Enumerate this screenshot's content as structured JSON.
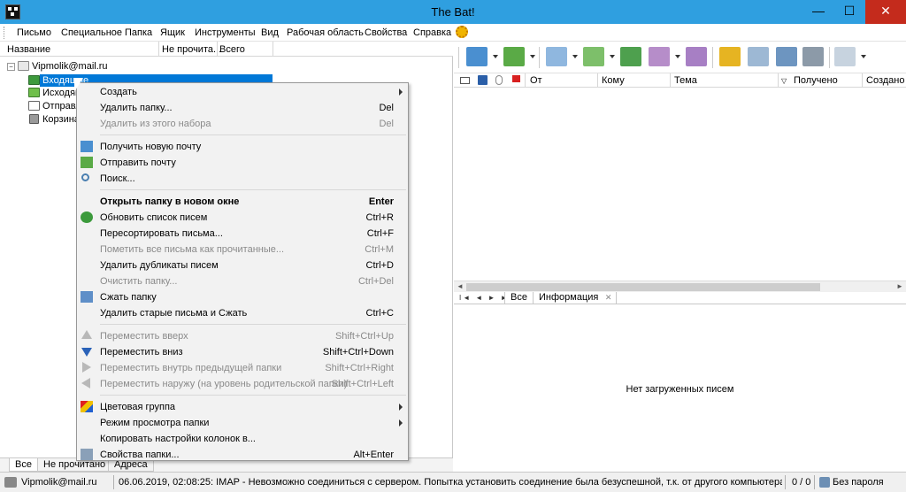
{
  "window": {
    "title": "The Bat!",
    "minimize": "—",
    "maximize": "☐",
    "close": "✕"
  },
  "menubar": [
    "Письмо",
    "Специальное",
    "Папка",
    "Ящик",
    "Инструменты",
    "Вид",
    "Рабочая область",
    "Свойства",
    "Справка"
  ],
  "folder_pane": {
    "columns": [
      "Название",
      "Не прочита...",
      "Всего"
    ],
    "account": "Vipmolik@mail.ru",
    "folders": [
      {
        "label": "Входящие",
        "icon": "inbox-icon",
        "selected": true
      },
      {
        "label": "Исходящие",
        "icon": "outbox-icon"
      },
      {
        "label": "Отправленные",
        "icon": "sent-icon"
      },
      {
        "label": "Корзина",
        "icon": "trash-icon"
      }
    ],
    "tabs": [
      "Все",
      "Не прочитано",
      "Адреса"
    ]
  },
  "context_menu": {
    "items": [
      {
        "label": "Создать",
        "shortcut": "",
        "submenu": true,
        "disabled": false
      },
      {
        "label": "Удалить папку...",
        "shortcut": "Del",
        "disabled": false
      },
      {
        "label": "Удалить из этого набора",
        "shortcut": "Del",
        "disabled": true
      },
      {
        "label": "Получить новую почту",
        "shortcut": "",
        "icon": "get-mail-icon"
      },
      {
        "label": "Отправить почту",
        "shortcut": "",
        "icon": "send-mail-icon"
      },
      {
        "label": "Поиск...",
        "shortcut": "",
        "icon": "search-icon"
      },
      {
        "label": "Открыть папку в новом окне",
        "shortcut": "Enter",
        "bold": true
      },
      {
        "label": "Обновить список писем",
        "shortcut": "Ctrl+R",
        "icon": "refresh-icon"
      },
      {
        "label": "Пересортировать письма...",
        "shortcut": "Ctrl+F"
      },
      {
        "label": "Пометить все письма как прочитанные...",
        "shortcut": "Ctrl+M",
        "disabled": true
      },
      {
        "label": "Удалить дубликаты писем",
        "shortcut": "Ctrl+D"
      },
      {
        "label": "Очистить папку...",
        "shortcut": "Ctrl+Del",
        "disabled": true
      },
      {
        "label": "Сжать папку",
        "shortcut": "",
        "icon": "compress-icon"
      },
      {
        "label": "Удалить старые письма и Сжать",
        "shortcut": "Ctrl+C"
      },
      {
        "label": "Переместить вверх",
        "shortcut": "Shift+Ctrl+Up",
        "disabled": true,
        "icon": "arrow-up-icon"
      },
      {
        "label": "Переместить вниз",
        "shortcut": "Shift+Ctrl+Down",
        "icon": "arrow-down-icon"
      },
      {
        "label": "Переместить внутрь предыдущей папки",
        "shortcut": "Shift+Ctrl+Right",
        "disabled": true,
        "icon": "arrow-right-icon"
      },
      {
        "label": "Переместить наружу (на уровень родительской папки)",
        "shortcut": "Shift+Ctrl+Left",
        "disabled": true,
        "icon": "arrow-left-icon"
      },
      {
        "label": "Цветовая группа",
        "shortcut": "",
        "submenu": true,
        "icon": "color-group-icon"
      },
      {
        "label": "Режим просмотра папки",
        "shortcut": "",
        "submenu": true
      },
      {
        "label": "Копировать настройки колонок в...",
        "shortcut": ""
      },
      {
        "label": "Свойства папки...",
        "shortcut": "Alt+Enter",
        "icon": "folder-properties-icon"
      }
    ]
  },
  "message_list": {
    "columns": [
      "От",
      "Кому",
      "Тема",
      "Получено",
      "Создано"
    ]
  },
  "view_tabs": {
    "nav": "I◄ ◄ ► ►I",
    "tabs": [
      "Все",
      "Информация"
    ],
    "close": "✕"
  },
  "preview": {
    "empty_text": "Нет загруженных писем"
  },
  "statusbar": {
    "account": "Vipmolik@mail.ru",
    "message": "06.06.2019, 02:08:25: IMAP  - Невозможно соединиться с сервером. Попытка установить соединение была безуспешной, т.к. от другого компьютера за требуемое вре...",
    "counts": "0 / 0",
    "password": "Без пароля"
  },
  "colors": {
    "titlebar": "#2f9fe0",
    "selection": "#0078d7",
    "close_button": "#c42b1c"
  }
}
